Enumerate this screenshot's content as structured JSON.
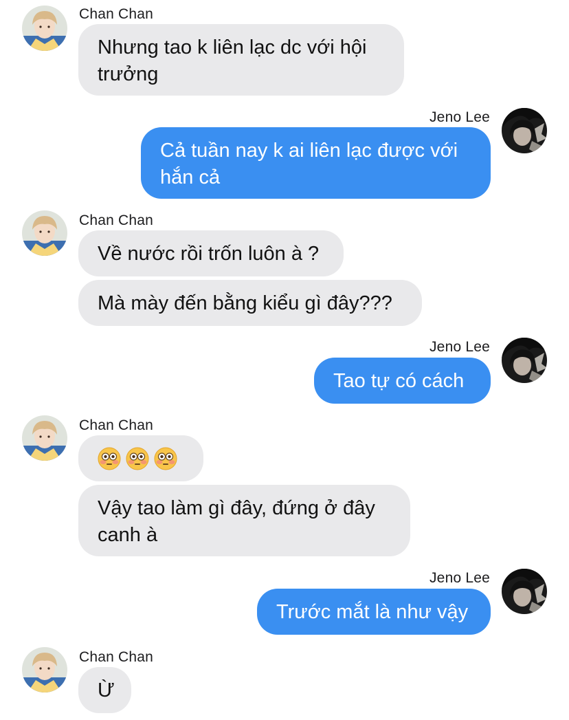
{
  "messages": [
    {
      "sender": "Chan Chan",
      "side": "in",
      "lines": [
        "Nhưng tao k liên lạc dc với hội",
        "trưởng"
      ]
    },
    {
      "sender": "Jeno Lee",
      "side": "out",
      "lines": [
        "Cả tuần nay k ai liên lạc được với",
        "hắn cả"
      ]
    },
    {
      "sender": "Chan Chan",
      "side": "in",
      "lines": [
        "Về nước rồi trốn luôn à ?"
      ]
    },
    {
      "sender": "Chan Chan",
      "side": "in",
      "lines": [
        "Mà mày đến bằng kiểu gì đây???"
      ]
    },
    {
      "sender": "Jeno Lee",
      "side": "out",
      "lines": [
        "Tao tự có cách"
      ]
    },
    {
      "sender": "Chan Chan",
      "side": "in",
      "emoji": [
        "😳",
        "😳",
        "😳"
      ]
    },
    {
      "sender": "Chan Chan",
      "side": "in",
      "lines": [
        "Vậy tao làm gì đây, đứng ở đây",
        "canh à"
      ]
    },
    {
      "sender": "Jeno Lee",
      "side": "out",
      "lines": [
        "Trước mắt là như vậy"
      ]
    },
    {
      "sender": "Chan Chan",
      "side": "in",
      "lines": [
        "Ừ"
      ]
    }
  ],
  "colors": {
    "incoming_bubble": "#e9e9eb",
    "outgoing_bubble": "#3a8ff1",
    "outgoing_text": "#ffffff"
  },
  "icons": {
    "flushed_face": "flushed-face-emoji",
    "chan_avatar": "chan-chan-avatar",
    "jeno_avatar": "jeno-lee-avatar"
  }
}
